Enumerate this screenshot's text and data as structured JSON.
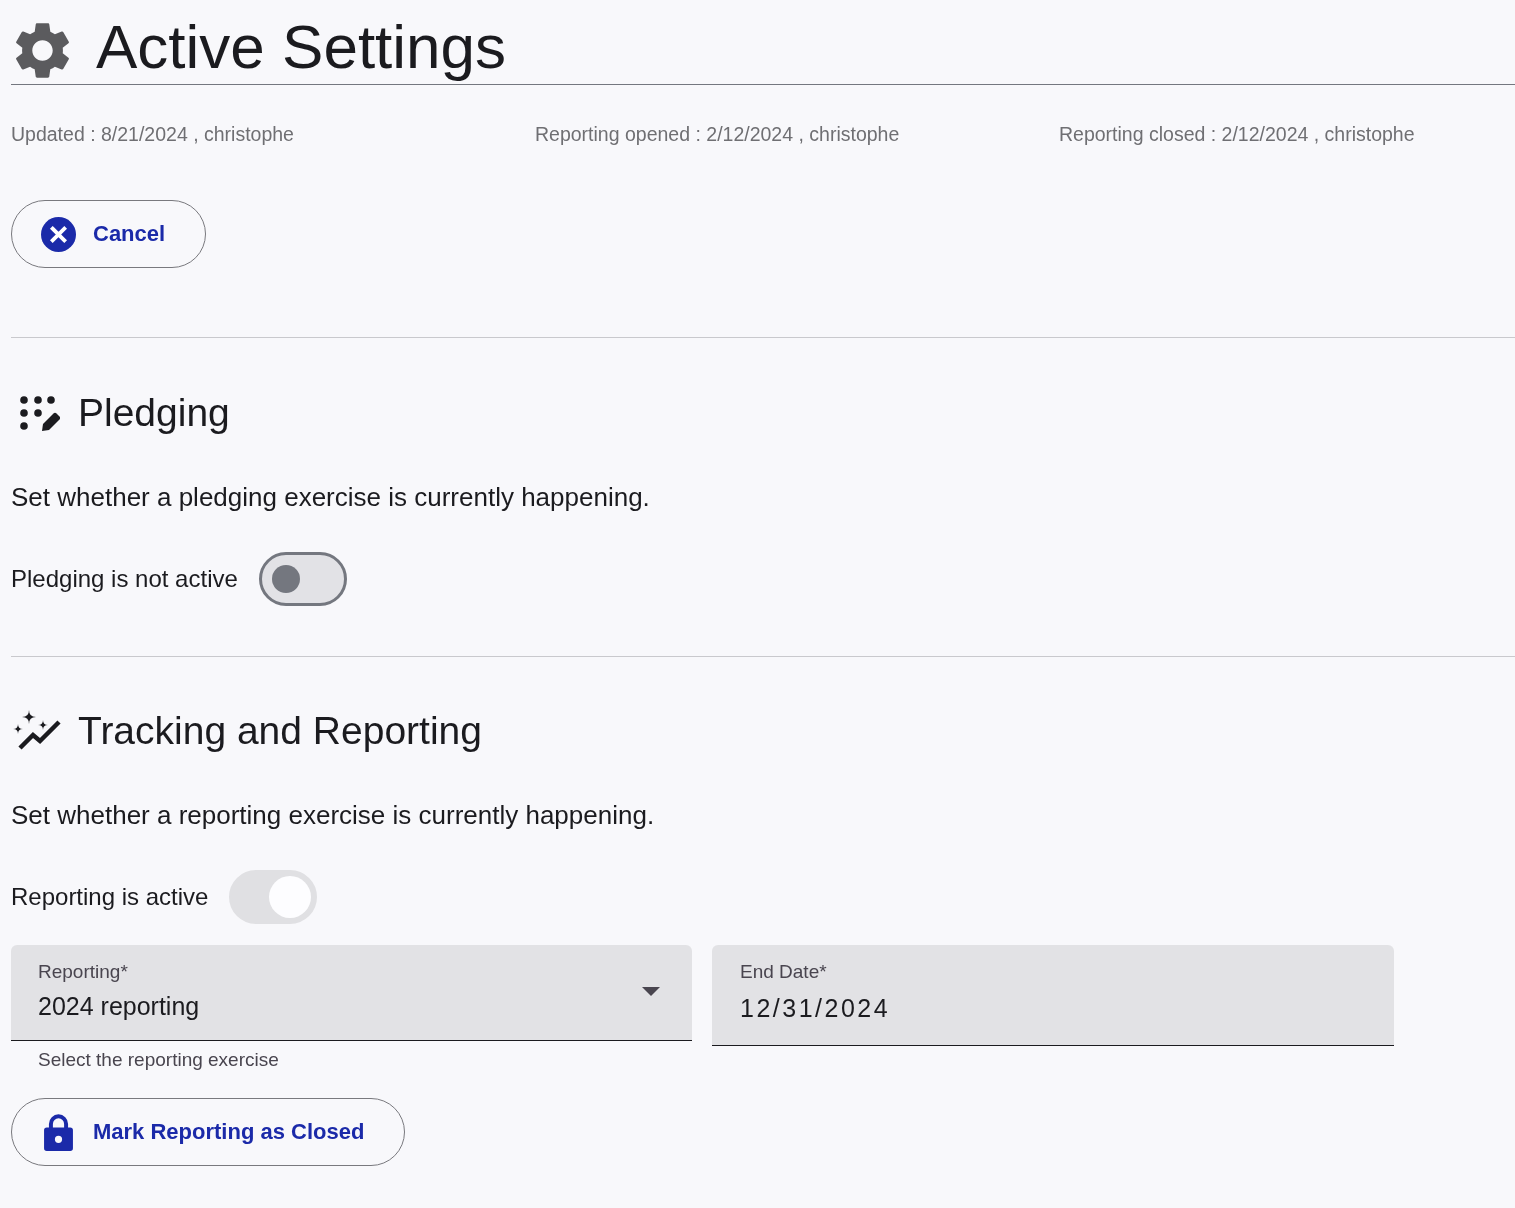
{
  "header": {
    "title": "Active Settings"
  },
  "audit": [
    "Updated : 8/21/2024 , christophe",
    "Reporting opened : 2/12/2024 , christophe",
    "Reporting closed : 2/12/2024 , christophe"
  ],
  "cancel_button": {
    "label": "Cancel"
  },
  "pledging": {
    "title": "Pledging",
    "description": "Set whether a pledging exercise is currently happening.",
    "toggle": {
      "label": "Pledging is not active",
      "on": false,
      "disabled": false
    }
  },
  "tracking": {
    "title": "Tracking and Reporting",
    "description": "Set whether a reporting exercise is currently happening.",
    "toggle": {
      "label": "Reporting is active",
      "on": true,
      "disabled": true
    },
    "fields": [
      {
        "kind": "select",
        "label": "Reporting*",
        "value": "2024 reporting",
        "helper": "Select the reporting exercise"
      },
      {
        "kind": "date",
        "label": "End Date*",
        "value": "12/31/2024"
      }
    ],
    "close_button": {
      "label": "Mark Reporting as Closed"
    }
  }
}
